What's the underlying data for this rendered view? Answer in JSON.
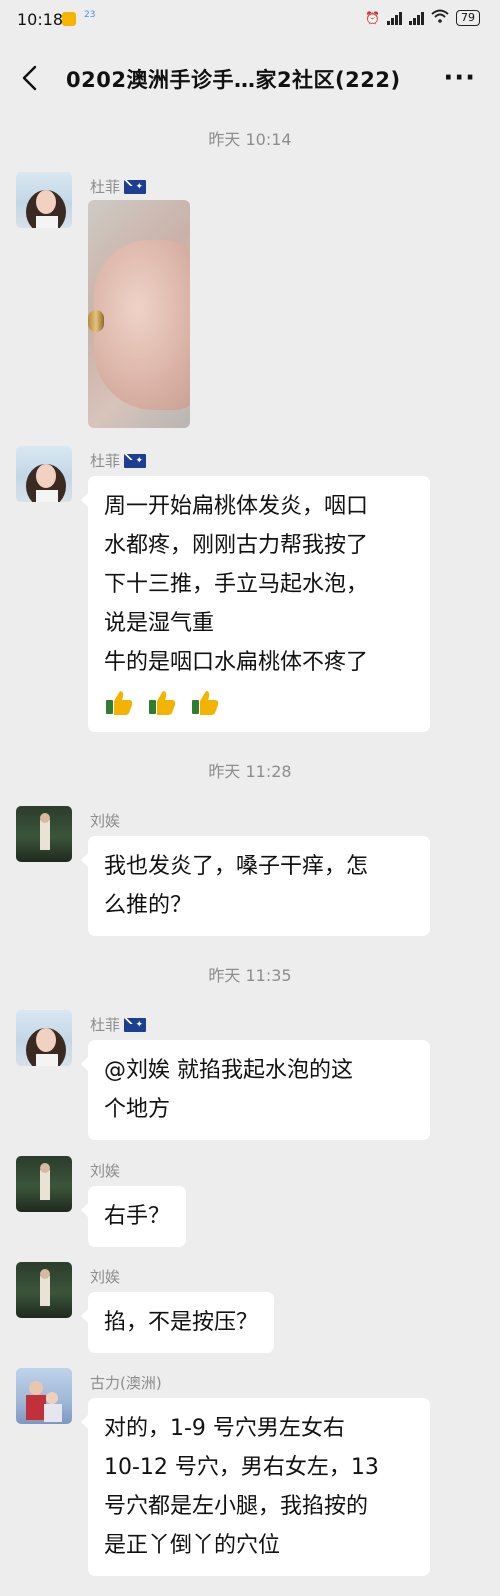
{
  "status_bar": {
    "time": "10:18",
    "tiny_icon_text": "23",
    "hd_label": "HD",
    "battery": "79"
  },
  "header": {
    "title": "0202澳洲手诊手…家2社区(222)",
    "back_icon": "chevron-left-icon",
    "more_icon": "ellipsis-icon",
    "more_glyph": "···"
  },
  "messages": [
    {
      "type": "timestamp",
      "text": "昨天 10:14"
    },
    {
      "type": "image",
      "sender": "杜菲",
      "flag": "australia-flag-icon"
    },
    {
      "type": "text",
      "sender": "杜菲",
      "flag": "australia-flag-icon",
      "lines": [
        "周一开始扁桃体发炎，咽口",
        "水都疼，刚刚古力帮我按了",
        "下十三推，手立马起水泡，",
        "说是湿气重",
        "牛的是咽口水扁桃体不疼了"
      ],
      "emoji": [
        "thumbs-up-icon",
        "thumbs-up-icon",
        "thumbs-up-icon"
      ]
    },
    {
      "type": "timestamp",
      "text": "昨天 11:28"
    },
    {
      "type": "text",
      "sender": "刘娭",
      "lines": [
        "我也发炎了，嗓子干痒，怎",
        "么推的？"
      ]
    },
    {
      "type": "timestamp",
      "text": "昨天 11:35"
    },
    {
      "type": "text",
      "sender": "杜菲",
      "flag": "australia-flag-icon",
      "lines": [
        "@刘娭  就掐我起水泡的这",
        "个地方"
      ]
    },
    {
      "type": "text",
      "sender": "刘娭",
      "lines": [
        "右手？"
      ]
    },
    {
      "type": "text",
      "sender": "刘娭",
      "lines": [
        "掐，不是按压？"
      ]
    },
    {
      "type": "text",
      "sender": "古力(澳洲)",
      "lines": [
        "对的，1-9 号穴男左女右",
        "10-12 号穴，男右女左，13",
        "号穴都是左小腿，我掐按的",
        "是正丫倒丫的穴位"
      ]
    }
  ]
}
